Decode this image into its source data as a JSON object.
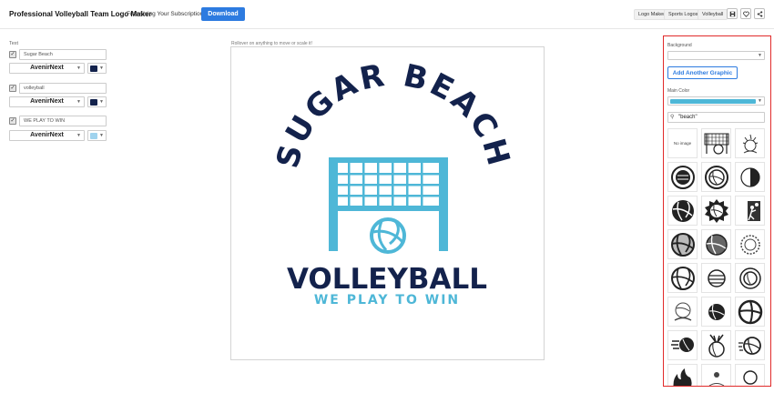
{
  "header": {
    "title": "Professional Volleyball Team Logo Maker",
    "subscription_note": "Free Using Your Subscription!",
    "download_label": "Download",
    "nav": [
      "Logo Maker",
      "Sports Logos",
      "Volleyball"
    ],
    "icons": [
      "save-icon",
      "heart-icon",
      "share-icon"
    ]
  },
  "text_panel": {
    "label": "Text",
    "rows": [
      {
        "value": "Sugar Beach",
        "font": "AvenirNext",
        "color": "#13224c"
      },
      {
        "value": "volleyball",
        "font": "AvenirNext",
        "color": "#13224c"
      },
      {
        "value": "WE PLAY TO WIN",
        "font": "AvenirNext",
        "color": "#9fd3ee"
      }
    ]
  },
  "canvas": {
    "hint": "Rollover on anything to move or scale it!",
    "logo": {
      "arc_text": "SUGAR BEACH",
      "main_text": "VOLLEYBALL",
      "tagline": "WE PLAY TO WIN",
      "navy": "#13224c",
      "sky": "#4eb7d7"
    }
  },
  "right_panel": {
    "background_label": "Background",
    "add_graphic_label": "Add Another Graphic",
    "main_color_label": "Main Color",
    "main_color": "#4eb7d7",
    "search_value": "\"beach\"",
    "no_image_label": "No image"
  }
}
